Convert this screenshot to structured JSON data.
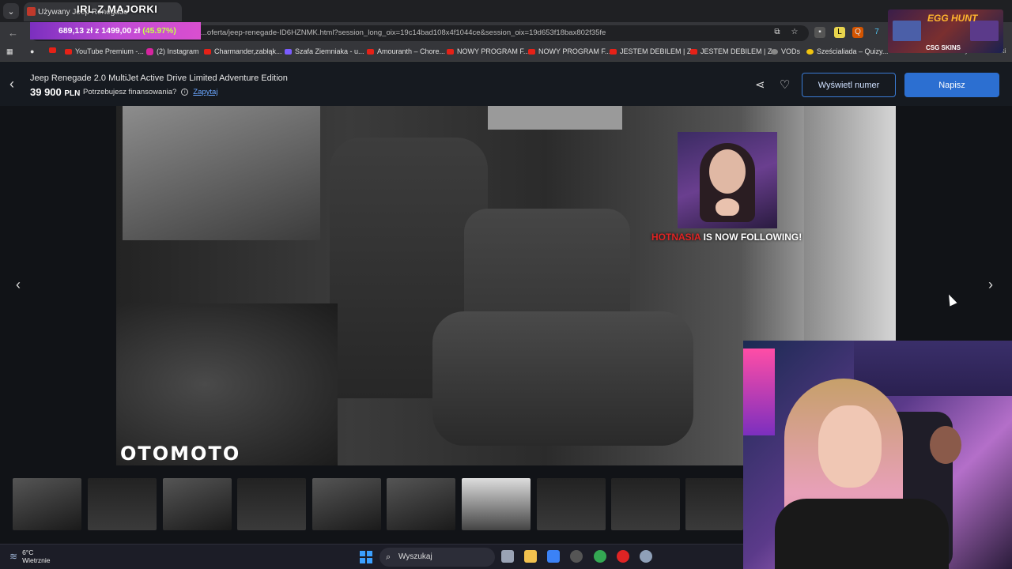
{
  "browser": {
    "tab_title": "Używany Jeep Renegade",
    "url_text": "...oferta/jeep-renegade-ID6HZNMK.html?session_long_oix=19c14bad108x4f1044ce&session_oix=19d653f18bax802f35fe",
    "bookmarks": [
      {
        "label": "YouTube Premium -...",
        "icon": "youtube-icon"
      },
      {
        "label": "(2) Instagram",
        "icon": "instagram-icon"
      },
      {
        "label": "Charmander,zabłąk...",
        "icon": "youtube-icon"
      },
      {
        "label": "Szafa Ziemniaka - u...",
        "icon": "twitch-icon"
      },
      {
        "label": "Amouranth – Chore...",
        "icon": "youtube-icon"
      },
      {
        "label": "NOWY PROGRAM F...",
        "icon": "youtube-icon"
      },
      {
        "label": "NOWY PROGRAM F...",
        "icon": "youtube-icon"
      },
      {
        "label": "JESTEM DEBILEM | Z...",
        "icon": "youtube-icon"
      },
      {
        "label": "JESTEM DEBILEM | Z...",
        "icon": "youtube-icon"
      },
      {
        "label": "VODs",
        "icon": "vods-icon"
      },
      {
        "label": "Sześcialiada – Quizy...",
        "icon": "quiz-icon"
      }
    ],
    "all_bookmarks": "Wszystkie zakładki"
  },
  "stream": {
    "channel_title": "IRL Z MAJORKI",
    "donation_text": "689,13 zł z 1499,00 zł",
    "donation_pct": "(45.97%)",
    "egg_title": "EGG HUNT",
    "egg_brand": "CSG SKINS",
    "follow_name": "HOTNASIA",
    "follow_msg": " IS NOW FOLLOWING!"
  },
  "listing": {
    "title": "Jeep Renegade 2.0 MultiJet Active Drive Limited Adventure Edition",
    "price": "39 900",
    "currency": "PLN",
    "financing": "Potrzebujesz finansowania?",
    "ask_link": "Zapytaj",
    "show_number": "Wyświetl numer",
    "write": "Napisz",
    "brand": "OTOMOTO",
    "thumb_count": 10
  },
  "taskbar": {
    "temp": "6°C",
    "weather": "Wietrznie",
    "search_placeholder": "Wyszukaj"
  },
  "colors": {
    "accent": "#2c6fd1",
    "link": "#6aa6ff",
    "donate_pct": "#c6ff4a"
  }
}
